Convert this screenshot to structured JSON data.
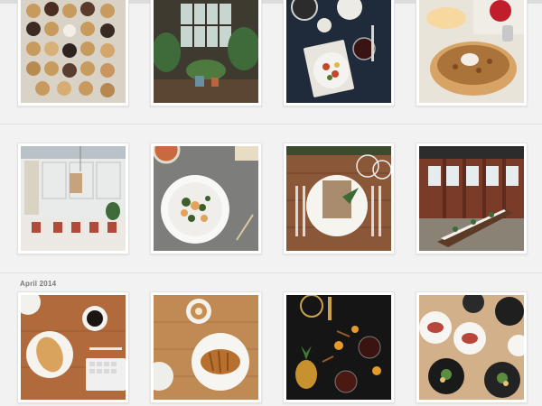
{
  "app": {
    "accent_colors": {
      "background": "#f2f2f2",
      "tile_border": "#e2e2e2",
      "label": "#7a7a7a"
    }
  },
  "sections": [
    {
      "label": "",
      "photos": [
        {
          "subject": "cookies-on-tray"
        },
        {
          "subject": "greenhouse-plants"
        },
        {
          "subject": "dinner-table-dark"
        },
        {
          "subject": "tart-and-wine"
        }
      ]
    },
    {
      "label": "",
      "photos": [
        {
          "subject": "white-dining-room"
        },
        {
          "subject": "plated-dish-gray-table"
        },
        {
          "subject": "place-setting-wood"
        },
        {
          "subject": "long-table-industrial-hall"
        }
      ]
    },
    {
      "label": "April 2014",
      "photos": [
        {
          "subject": "breakfast-croissant-coffee"
        },
        {
          "subject": "croissant-and-latte"
        },
        {
          "subject": "cocktails-pineapple-dark"
        },
        {
          "subject": "plates-of-food-overhead"
        }
      ]
    }
  ]
}
